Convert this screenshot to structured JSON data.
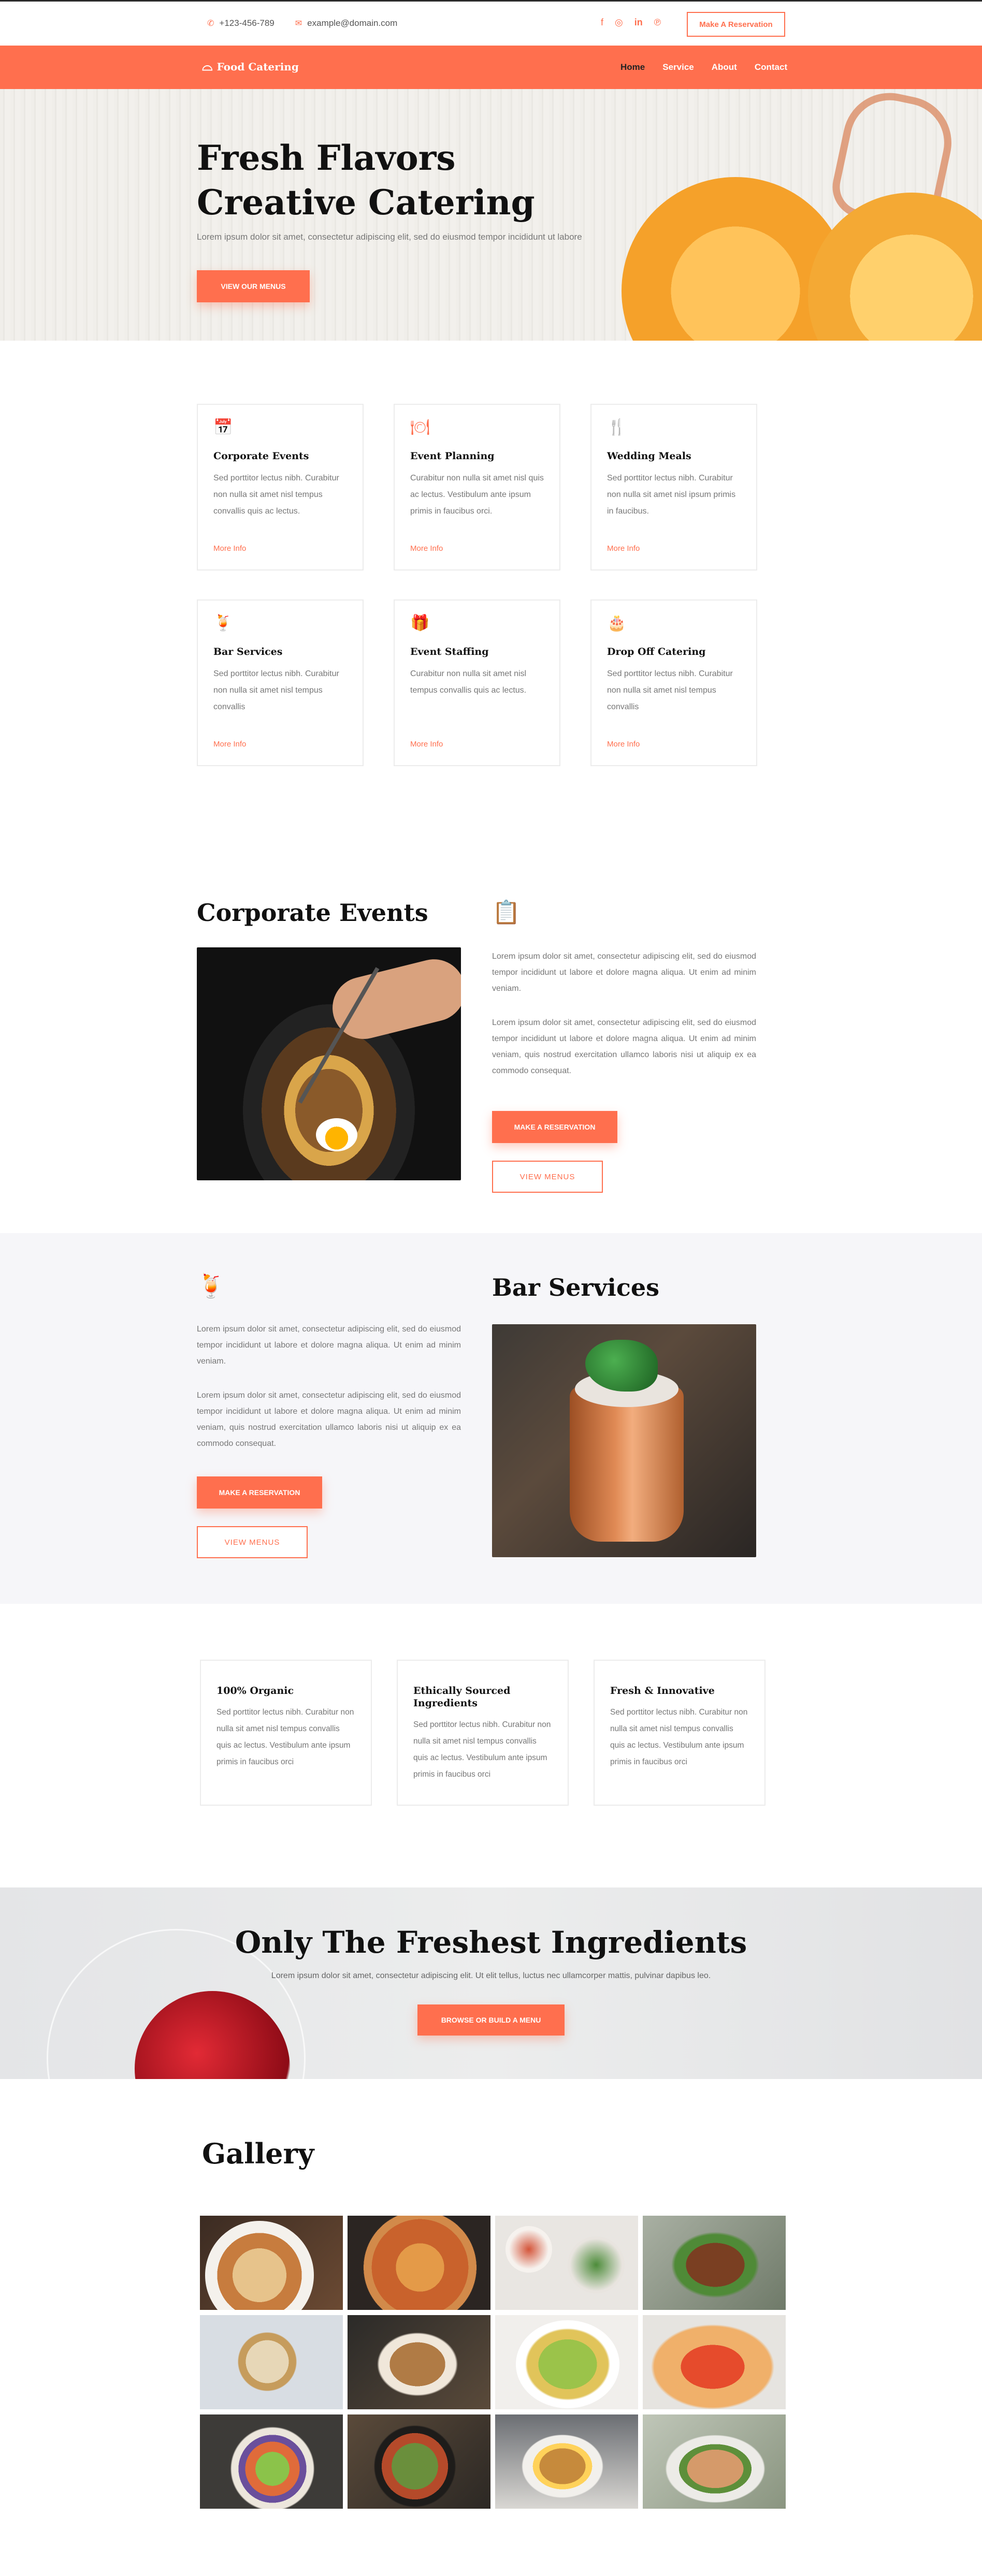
{
  "topbar": {
    "phone": "+123-456-789",
    "email": "example@domain.com",
    "social_icons": [
      "facebook-icon",
      "instagram-icon",
      "linkedin-icon",
      "pinterest-icon"
    ],
    "reserve_label": "Make A Reservation"
  },
  "nav": {
    "brand": "Food Catering",
    "items": [
      "Home",
      "Service",
      "About",
      "Contact"
    ],
    "active": "Home"
  },
  "hero": {
    "title": "Fresh Flavors Creative Catering",
    "text": "Lorem ipsum dolor sit amet, consectetur adipiscing elit, sed do eiusmod tempor incididunt ut labore",
    "button": "VIEW OUR MENUS"
  },
  "services": {
    "more_label": "More Info",
    "items": [
      {
        "title": "Corporate Events",
        "text": "Sed porttitor lectus nibh. Curabitur non nulla sit amet nisl tempus convallis quis ac lectus.",
        "icon": "calendar-icon"
      },
      {
        "title": "Event Planning",
        "text": "Curabitur non nulla sit amet nisl quis ac lectus. Vestibulum ante ipsum primis in faucibus orci.",
        "icon": "dining-table-icon"
      },
      {
        "title": "Wedding Meals",
        "text": "Sed porttitor lectus nibh. Curabitur non nulla sit amet nisl ipsum primis in faucibus.",
        "icon": "wedding-table-icon"
      },
      {
        "title": "Bar Services",
        "text": "Sed porttitor lectus nibh. Curabitur non nulla sit amet nisl tempus convallis",
        "icon": "cocktail-icon"
      },
      {
        "title": "Event Staffing",
        "text": "Curabitur non nulla sit amet nisl tempus convallis quis ac lectus.",
        "icon": "gift-icon"
      },
      {
        "title": "Drop Off Catering",
        "text": "Sed porttitor lectus nibh. Curabitur non nulla sit amet nisl tempus convallis",
        "icon": "cake-icon"
      }
    ]
  },
  "corporate": {
    "title": "Corporate Events",
    "icon": "notepad-icon",
    "para1": "Lorem ipsum dolor sit amet, consectetur adipiscing elit, sed do eiusmod tempor incididunt ut labore et dolore magna aliqua. Ut enim ad minim veniam.",
    "para2": "Lorem ipsum dolor sit amet, consectetur adipiscing elit, sed do eiusmod tempor incididunt ut labore et dolore magna aliqua. Ut enim ad minim veniam, quis nostrud exercitation ullamco laboris nisi ut aliquip ex ea commodo consequat.",
    "button": "MAKE A RESERVATION",
    "outline_button": "VIEW MENUS"
  },
  "bar": {
    "title": "Bar Services",
    "icon": "cocktail-icon",
    "para1": "Lorem ipsum dolor sit amet, consectetur adipiscing elit, sed do eiusmod tempor incididunt ut labore et dolore magna aliqua. Ut enim ad minim veniam.",
    "para2": "Lorem ipsum dolor sit amet, consectetur adipiscing elit, sed do eiusmod tempor incididunt ut labore et dolore magna aliqua. Ut enim ad minim veniam, quis nostrud exercitation ullamco laboris nisi ut aliquip ex ea commodo consequat.",
    "button": "MAKE A RESERVATION",
    "outline_button": "VIEW MENUS"
  },
  "values": [
    {
      "title": "100% Organic",
      "text": "Sed porttitor lectus nibh. Curabitur non nulla sit amet nisl tempus convallis quis ac lectus. Vestibulum ante ipsum primis in faucibus orci"
    },
    {
      "title": "Ethically Sourced Ingredients",
      "text": "Sed porttitor lectus nibh. Curabitur non nulla sit amet nisl tempus convallis quis ac lectus. Vestibulum ante ipsum primis in faucibus orci"
    },
    {
      "title": "Fresh & Innovative",
      "text": "Sed porttitor lectus nibh. Curabitur non nulla sit amet nisl tempus convallis quis ac lectus. Vestibulum ante ipsum primis in faucibus orci"
    }
  ],
  "freshest": {
    "title": "Only The Freshest Ingredients",
    "text": "Lorem ipsum dolor sit amet, consectetur adipiscing elit. Ut elit tellus, luctus nec ullamcorper mattis, pulvinar dapibus leo.",
    "button": "BROWSE OR BUILD A MENU"
  },
  "gallery": {
    "title": "Gallery"
  },
  "colors": {
    "accent": "#ff6f4e",
    "section_bg": "#f6f6f9"
  }
}
